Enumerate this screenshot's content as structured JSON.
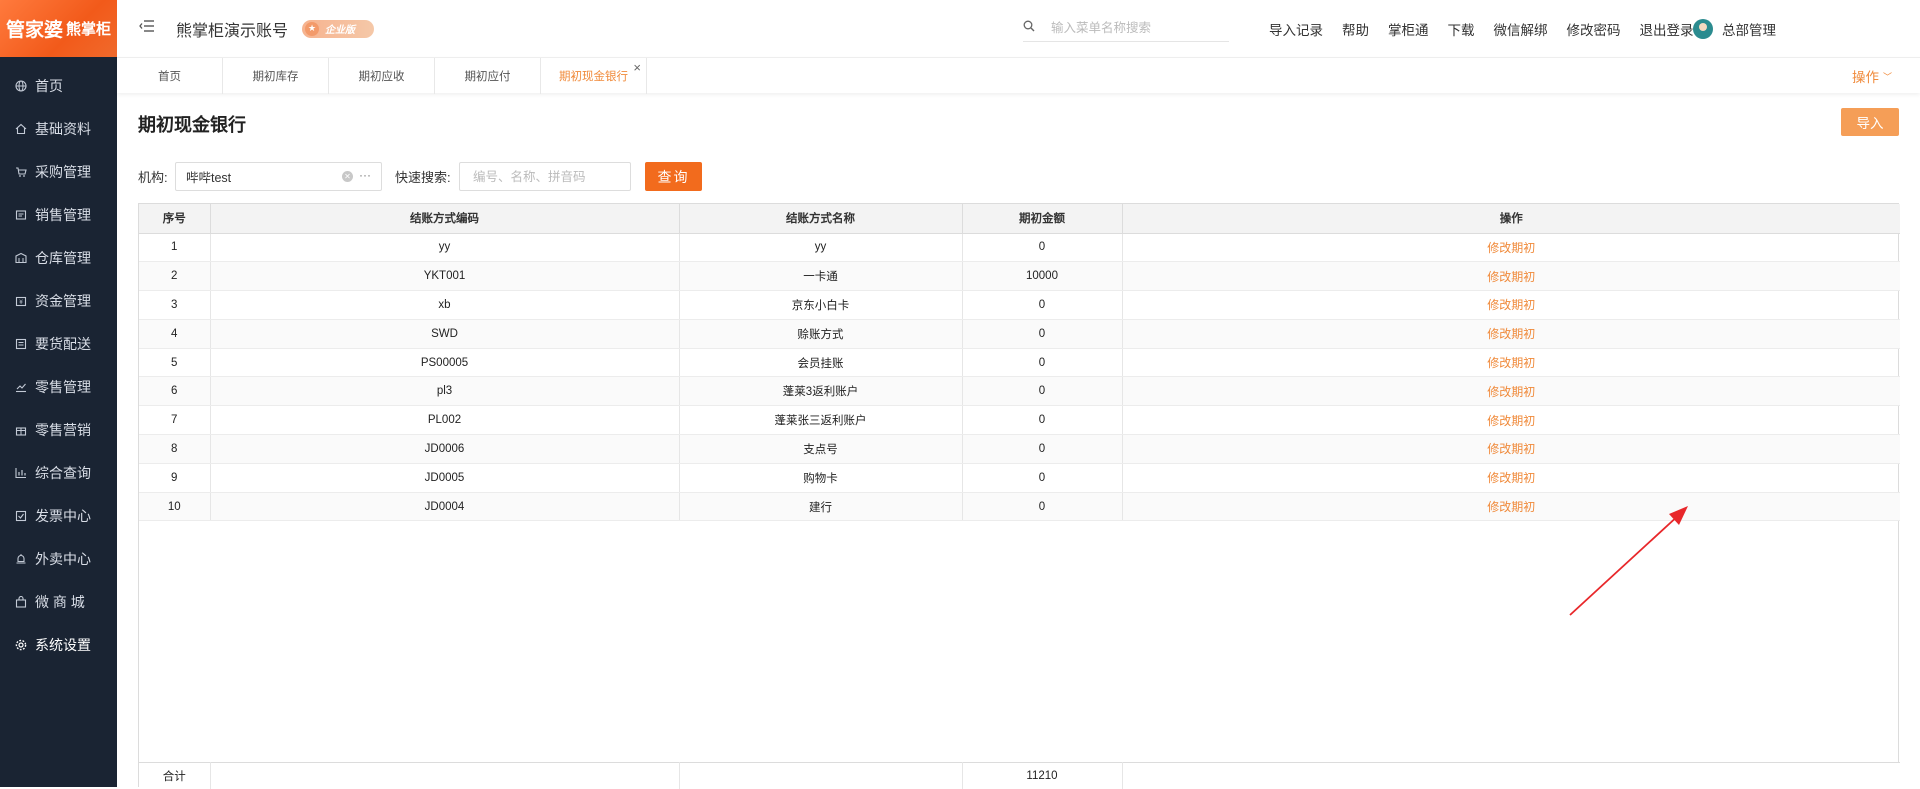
{
  "sidebar": {
    "logo_main": "管家婆",
    "logo_sub": "熊掌柜",
    "items": [
      {
        "label": "首页",
        "icon": "globe-icon"
      },
      {
        "label": "基础资料",
        "icon": "home-icon"
      },
      {
        "label": "采购管理",
        "icon": "cart-icon"
      },
      {
        "label": "销售管理",
        "icon": "receipt-icon"
      },
      {
        "label": "仓库管理",
        "icon": "warehouse-icon"
      },
      {
        "label": "资金管理",
        "icon": "wallet-icon"
      },
      {
        "label": "要货配送",
        "icon": "list-icon"
      },
      {
        "label": "零售管理",
        "icon": "chart-icon"
      },
      {
        "label": "零售营销",
        "icon": "gift-icon"
      },
      {
        "label": "综合查询",
        "icon": "bar-chart-icon"
      },
      {
        "label": "发票中心",
        "icon": "invoice-icon"
      },
      {
        "label": "外卖中心",
        "icon": "bell-icon"
      },
      {
        "label": "微 商 城",
        "icon": "bag-icon"
      },
      {
        "label": "系统设置",
        "icon": "gear-icon"
      }
    ],
    "active": "系统设置"
  },
  "header": {
    "account_name": "熊掌柜演示账号",
    "badge": "企业版",
    "search_placeholder": "输入菜单名称搜索",
    "links": [
      "导入记录",
      "帮助",
      "掌柜通",
      "下载",
      "微信解绑",
      "修改密码",
      "退出登录"
    ],
    "user_name": "总部管理"
  },
  "tabs": {
    "items": [
      "首页",
      "期初库存",
      "期初应收",
      "期初应付",
      "期初现金银行"
    ],
    "active": "期初现金银行",
    "ops_label": "操作"
  },
  "page": {
    "title": "期初现金银行",
    "import_label": "导入",
    "org_label": "机构:",
    "org_value": "哔哔test",
    "quick_search_label": "快速搜索:",
    "quick_search_placeholder": "编号、名称、拼音码",
    "query_label": "查询"
  },
  "table": {
    "columns": [
      "序号",
      "结账方式编码",
      "结账方式名称",
      "期初金额",
      "操作"
    ],
    "rows": [
      {
        "no": "1",
        "code": "yy",
        "name": "yy",
        "amount": "0",
        "op": "修改期初"
      },
      {
        "no": "2",
        "code": "YKT001",
        "name": "一卡通",
        "amount": "10000",
        "op": "修改期初"
      },
      {
        "no": "3",
        "code": "xb",
        "name": "京东小白卡",
        "amount": "0",
        "op": "修改期初"
      },
      {
        "no": "4",
        "code": "SWD",
        "name": "赊账方式",
        "amount": "0",
        "op": "修改期初"
      },
      {
        "no": "5",
        "code": "PS00005",
        "name": "会员挂账",
        "amount": "0",
        "op": "修改期初"
      },
      {
        "no": "6",
        "code": "pl3",
        "name": "蓬莱3返利账户",
        "amount": "0",
        "op": "修改期初"
      },
      {
        "no": "7",
        "code": "PL002",
        "name": "蓬莱张三返利账户",
        "amount": "0",
        "op": "修改期初"
      },
      {
        "no": "8",
        "code": "JD0006",
        "name": "支点号",
        "amount": "0",
        "op": "修改期初"
      },
      {
        "no": "9",
        "code": "JD0005",
        "name": "购物卡",
        "amount": "0",
        "op": "修改期初"
      },
      {
        "no": "10",
        "code": "JD0004",
        "name": "建行",
        "amount": "0",
        "op": "修改期初"
      }
    ],
    "total_label": "合计",
    "total_amount": "11210"
  },
  "colors": {
    "accent": "#f26b1d",
    "link": "#f08a3a",
    "sidebar_bg": "#1a2433",
    "arrow": "#e8272a"
  }
}
